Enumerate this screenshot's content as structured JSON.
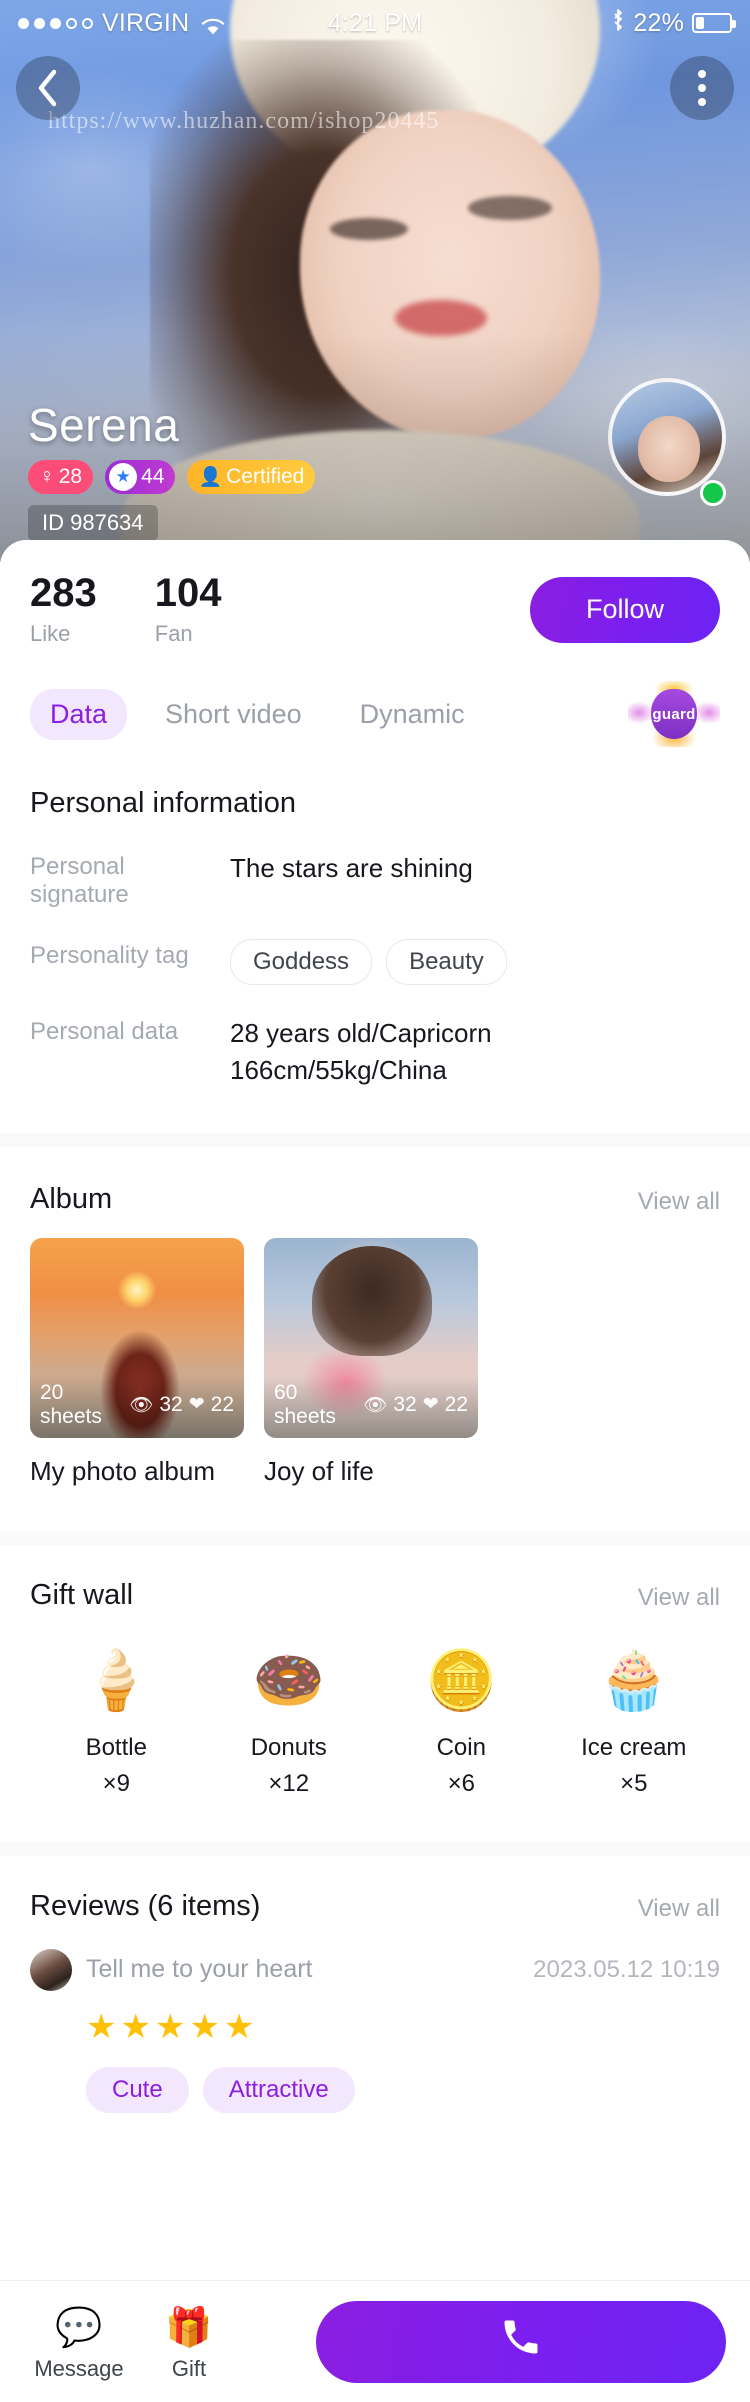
{
  "status_bar": {
    "carrier": "VIRGIN",
    "signal_dots_filled": 3,
    "signal_dots_total": 5,
    "wifi_icon": "wifi-icon",
    "time": "4:21 PM",
    "bluetooth_icon": "bluetooth-icon",
    "battery_percent": "22%",
    "battery_icon": "battery-icon"
  },
  "hero": {
    "back_icon": "chevron-left-icon",
    "more_icon": "more-vertical-icon",
    "watermark": "https://www.huzhan.com/ishop20445",
    "name": "Serena",
    "gender_badge": "28",
    "gender_icon": "female-icon",
    "level_badge": "44",
    "level_icon": "star-icon",
    "certified_badge": "Certified",
    "certified_icon": "verified-user-icon",
    "id_label": "ID 987634",
    "avatar_name": "profile-avatar",
    "online_status": "online"
  },
  "stats": {
    "items": [
      {
        "value": "283",
        "label": "Like"
      },
      {
        "value": "104",
        "label": "Fan"
      }
    ],
    "follow_label": "Follow"
  },
  "tabs": {
    "items": [
      {
        "label": "Data",
        "active": true
      },
      {
        "label": "Short video",
        "active": false
      },
      {
        "label": "Dynamic",
        "active": false
      }
    ],
    "guard_label": "guard"
  },
  "personal_information": {
    "title": "Personal information",
    "signature_key": "Personal signature",
    "signature_value": "The stars are shining",
    "personality_key": "Personality tag",
    "personality_tags": [
      "Goddess",
      "Beauty"
    ],
    "data_key": "Personal data",
    "data_line1": "28 years old/Capricorn",
    "data_line2": "166cm/55kg/China"
  },
  "album": {
    "title": "Album",
    "view_all": "View all",
    "items": [
      {
        "sheets": "20 sheets",
        "views": "32",
        "likes": "22",
        "name": "My photo album"
      },
      {
        "sheets": "60 sheets",
        "views": "32",
        "likes": "22",
        "name": "Joy of life"
      }
    ],
    "view_icon": "eye-icon",
    "like_icon": "heart-icon"
  },
  "gift_wall": {
    "title": "Gift wall",
    "view_all": "View all",
    "items": [
      {
        "icon": "ice-cream-cone-icon",
        "glyph": "🍦",
        "name": "Bottle",
        "count": "×9"
      },
      {
        "icon": "donut-icon",
        "glyph": "🍩",
        "name": "Donuts",
        "count": "×12"
      },
      {
        "icon": "coin-icon",
        "glyph": "🪙",
        "name": "Coin",
        "count": "×6"
      },
      {
        "icon": "cupcake-icon",
        "glyph": "🧁",
        "name": "Ice cream",
        "count": "×5"
      }
    ]
  },
  "reviews": {
    "title": "Reviews (6 items)",
    "view_all": "View all",
    "entry": {
      "author": "Tell me to your heart",
      "date": "2023.05.12 10:19",
      "stars": "★★★★★",
      "rating": 5,
      "tags": [
        "Cute",
        "Attractive"
      ]
    }
  },
  "bottom_bar": {
    "items": [
      {
        "icon": "message-bubble-icon",
        "glyph": "💬",
        "label": "Message"
      },
      {
        "icon": "gift-box-icon",
        "glyph": "🎁",
        "label": "Gift"
      }
    ],
    "call_icon": "phone-icon",
    "call_glyph": "📞"
  },
  "colors": {
    "accent_purple": "#8b1ee0",
    "badge_pink": "#fc4d79",
    "badge_yellow": "#ffb427",
    "online_green": "#14c64a",
    "star_gold": "#ffc107"
  }
}
